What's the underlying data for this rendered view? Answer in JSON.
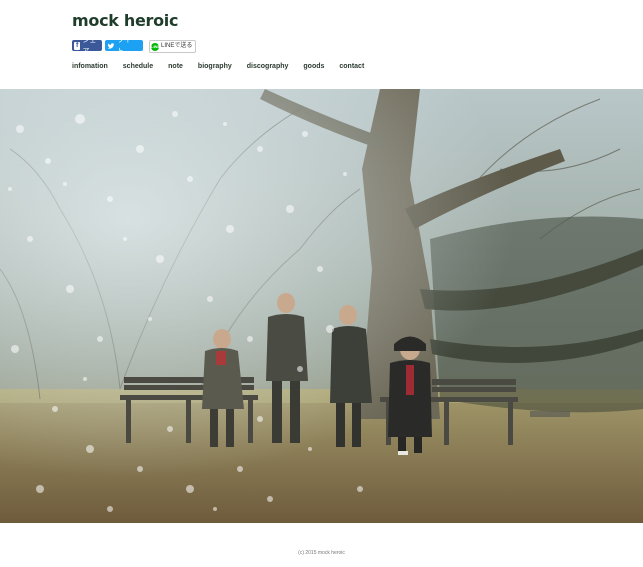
{
  "site": {
    "logo_text": "mock heroic"
  },
  "share": {
    "facebook_label": "シェア",
    "twitter_label": "ツイート",
    "line_label": "LINEで送る",
    "line_icon_text": "LINE",
    "facebook_icon": "facebook-icon",
    "twitter_icon": "twitter-bird-icon",
    "line_icon": "line-icon"
  },
  "nav": {
    "items": [
      {
        "label": "infomation"
      },
      {
        "label": "schedule"
      },
      {
        "label": "note"
      },
      {
        "label": "biography"
      },
      {
        "label": "discography"
      },
      {
        "label": "goods"
      },
      {
        "label": "contact"
      }
    ]
  },
  "hero": {
    "description_icon": "band-photo-park-trees"
  },
  "footer": {
    "copyright": "(c) 2015 mock heroic"
  },
  "colors": {
    "logo": "#1f3d2a",
    "nav_text": "#2b3a2f",
    "facebook": "#3b5998",
    "twitter": "#1da1f2",
    "line": "#00b900",
    "footer_text": "#777777"
  }
}
